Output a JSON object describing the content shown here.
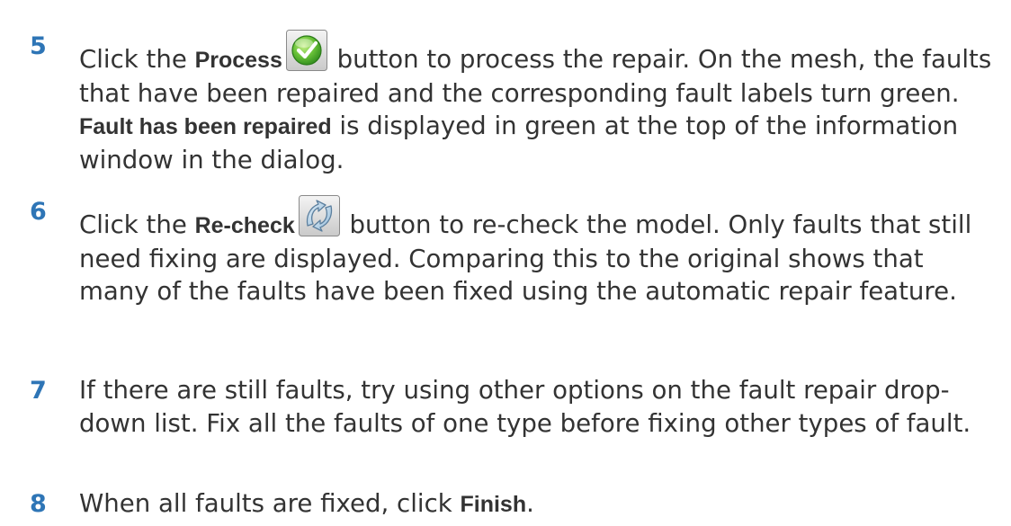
{
  "steps": [
    {
      "number": "5",
      "pre": "Click the ",
      "bold1": "Process",
      "icon": "process-checkmark-icon",
      "mid": " button to process the repair. On the mesh, the faults that have been repaired and the corresponding fault labels turn green. ",
      "bold2": "Fault has been repaired",
      "post": " is displayed in green at the top of the information window in the dialog."
    },
    {
      "number": "6",
      "pre": "Click the ",
      "bold1": "Re-check",
      "icon": "recheck-arrows-icon",
      "post": " button to re-check the model. Only faults that still need fixing are displayed. Comparing this to the original shows that many of the faults have been fixed using the automatic repair feature."
    },
    {
      "number": "7",
      "text": "If there are still faults, try using other options on the fault repair drop-down list. Fix all the faults of one type before fixing other types of fault."
    },
    {
      "number": "8",
      "pre": "When all faults are fixed, click ",
      "bold1": "Finish",
      "post": "."
    }
  ],
  "colors": {
    "step_number": "#2e75b6",
    "body_text": "#333333"
  }
}
